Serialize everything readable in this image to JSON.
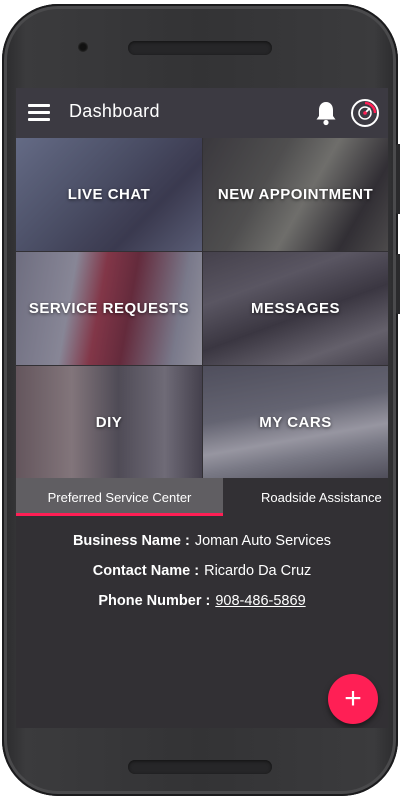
{
  "appbar": {
    "title": "Dashboard",
    "menu_icon": "hamburger-menu-icon",
    "notification_icon": "bell-icon",
    "profile_icon": "gauge-icon"
  },
  "tiles": [
    {
      "label": "LIVE CHAT"
    },
    {
      "label": "NEW APPOINTMENT"
    },
    {
      "label": "SERVICE REQUESTS"
    },
    {
      "label": "MESSAGES"
    },
    {
      "label": "DIY"
    },
    {
      "label": "MY CARS"
    }
  ],
  "tabs": {
    "active": "Preferred Service Center",
    "inactive": "Roadside Assistance"
  },
  "details": {
    "business_key": "Business Name :",
    "business_val": "Joman Auto Services",
    "contact_key": "Contact Name :",
    "contact_val": "Ricardo Da Cruz",
    "phone_key": "Phone Number :",
    "phone_val": "908-486-5869"
  },
  "fab": {
    "symbol": "+"
  },
  "colors": {
    "accent": "#ff1f55",
    "appbar": "#3c3a42",
    "background": "#323034",
    "active_tab": "#605e62"
  }
}
